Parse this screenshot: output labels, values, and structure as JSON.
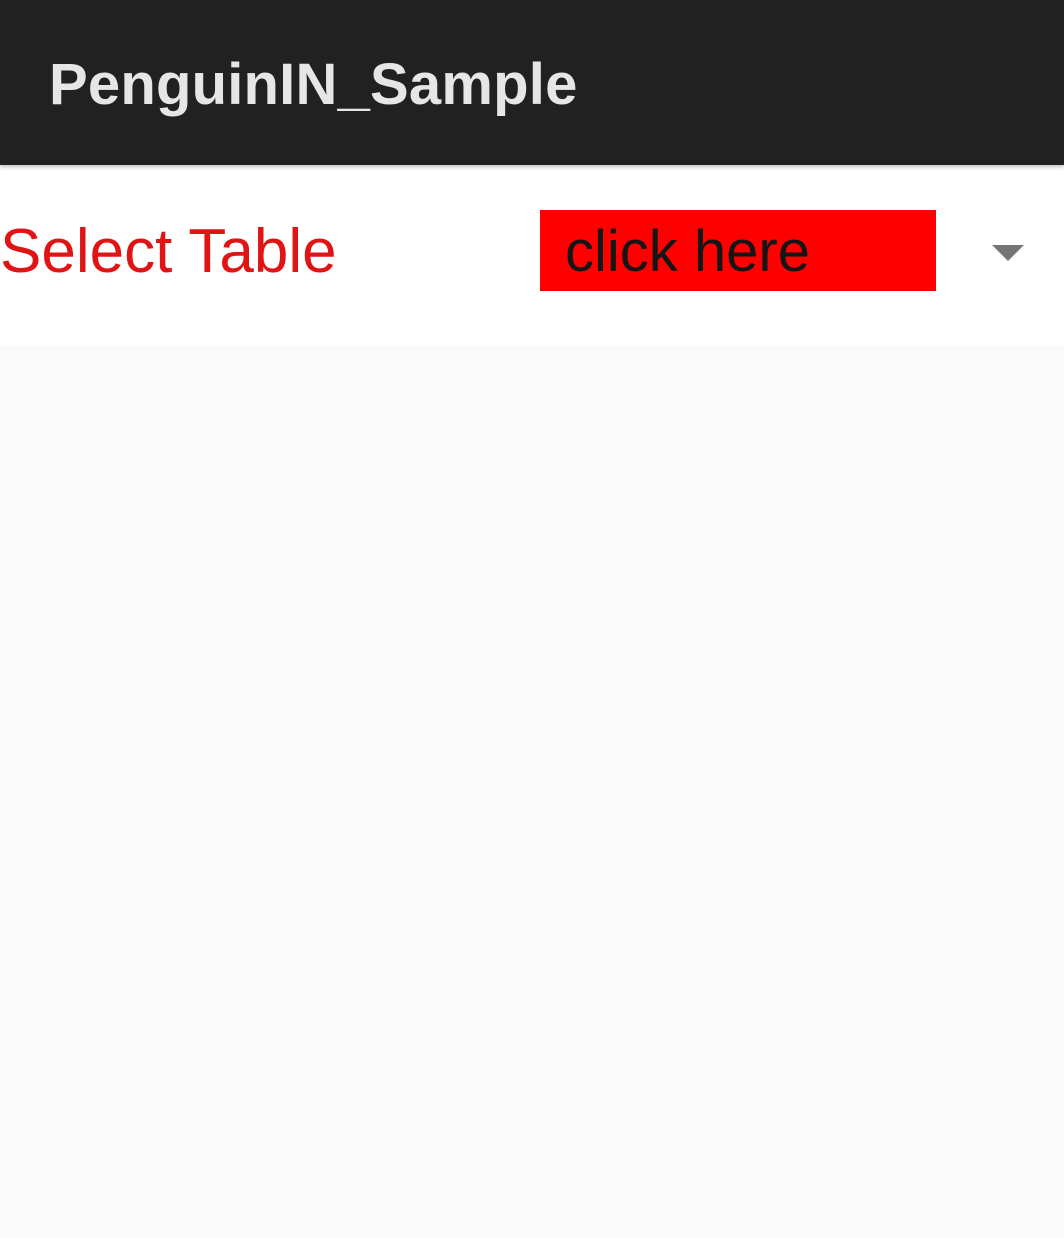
{
  "app_bar": {
    "title": "PenguinIN_Sample"
  },
  "table_selector": {
    "label": "Select Table",
    "spinner_value": "click here",
    "arrow_icon": "chevron-down-icon"
  },
  "colors": {
    "app_bar_background": "#212121",
    "app_bar_title": "#e6e6e6",
    "label_text": "#e01414",
    "spinner_background": "#ff0000",
    "spinner_text": "#151515",
    "content_background": "#fafafa"
  }
}
